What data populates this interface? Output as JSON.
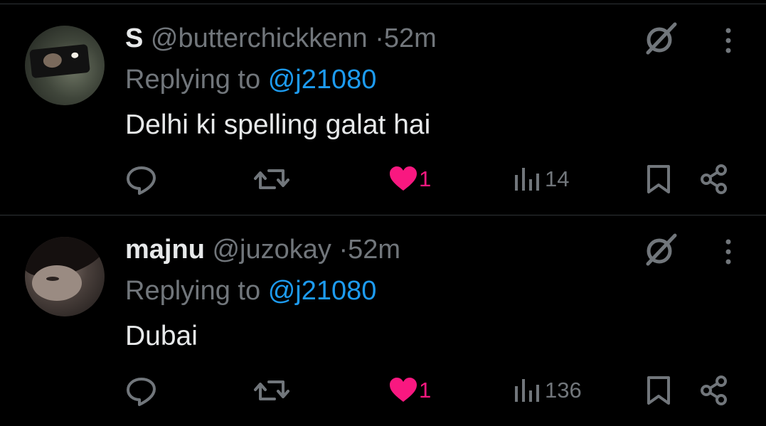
{
  "tweets": [
    {
      "name": "S",
      "handle": "@butterchickkenn",
      "separator": "·",
      "time": "52m",
      "reply_prefix": "Replying to",
      "reply_to": "@j21080",
      "text": "Delhi ki spelling galat hai",
      "likes": "1",
      "views": "14"
    },
    {
      "name": "majnu",
      "handle": "@juzokay",
      "separator": "·",
      "time": "52m",
      "reply_prefix": "Replying to",
      "reply_to": "@j21080",
      "text": "Dubai",
      "likes": "1",
      "views": "136"
    }
  ],
  "colors": {
    "background": "#000000",
    "text_primary": "#e7e9ea",
    "text_secondary": "#71767b",
    "link": "#1d9bf0",
    "like": "#f91880",
    "divider": "#2f3336"
  },
  "icons": [
    "reply-icon",
    "retweet-icon",
    "heart-icon",
    "views-icon",
    "bookmark-icon",
    "share-icon",
    "grok-icon",
    "more-icon"
  ]
}
